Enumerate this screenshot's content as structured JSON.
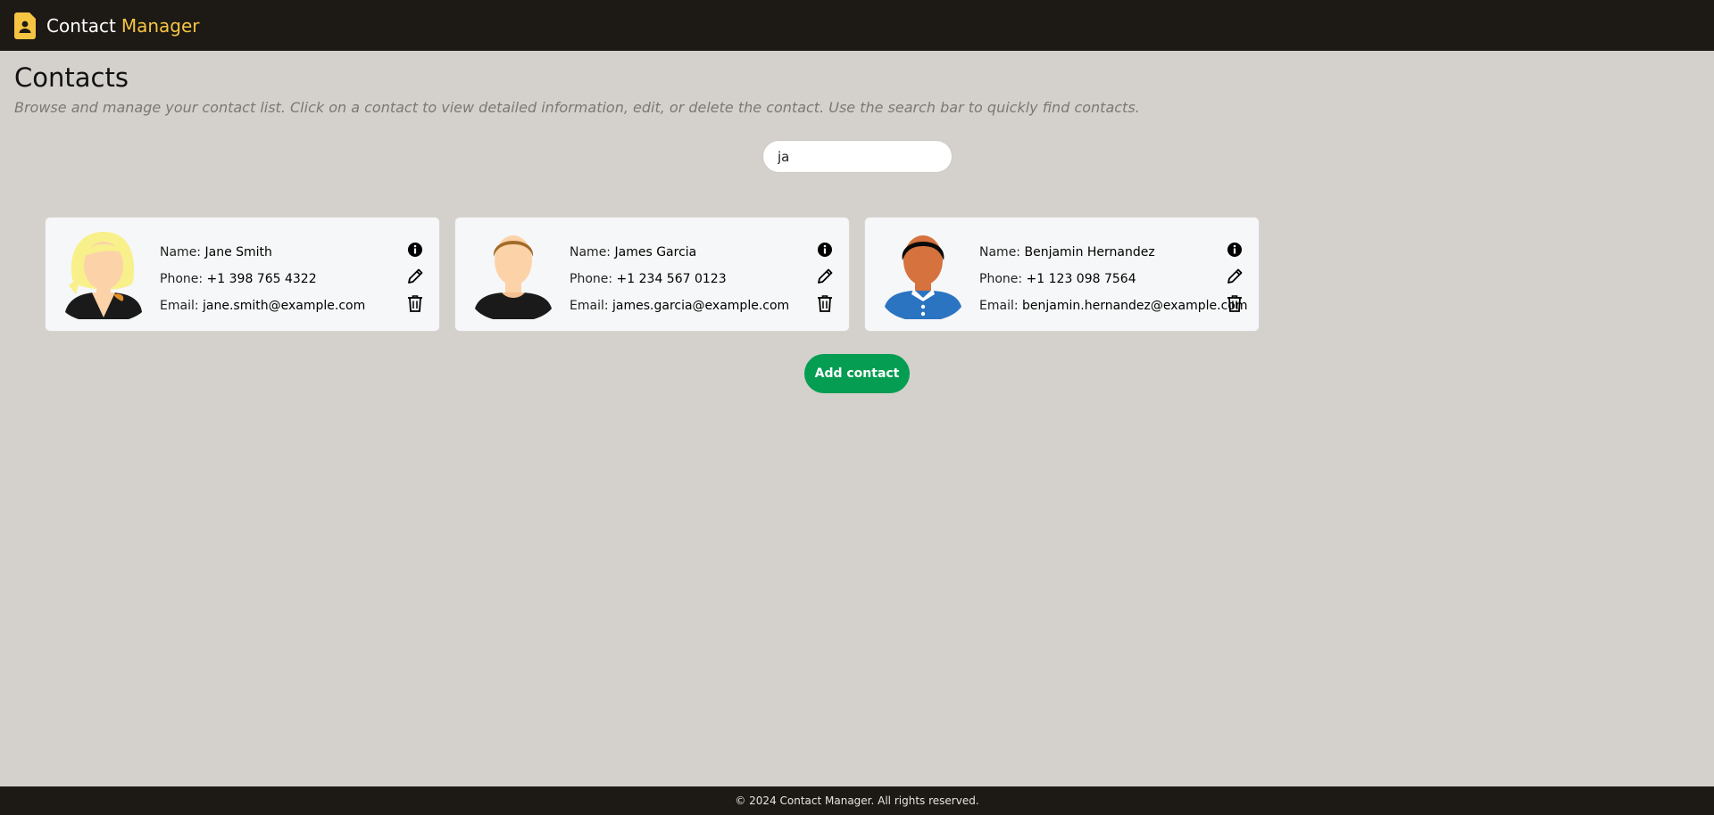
{
  "header": {
    "brand_primary": "Contact",
    "brand_accent": "Manager",
    "accent_color": "#f5c542",
    "logo_icon": "contact-book-icon"
  },
  "main": {
    "title": "Contacts",
    "description": "Browse and manage your contact list. Click on a contact to view detailed information, edit, or delete the contact. Use the search bar to quickly find contacts.",
    "search_value": "ja"
  },
  "labels": {
    "name": "Name:",
    "phone": "Phone:",
    "email": "Email:"
  },
  "contacts": [
    {
      "name": "Jane Smith",
      "phone": "+1 398 765 4322",
      "email": "jane.smith@example.com",
      "avatar": "blonde-woman-avatar"
    },
    {
      "name": "James Garcia",
      "phone": "+1 234 567 0123",
      "email": "james.garcia@example.com",
      "avatar": "brown-haired-man-avatar"
    },
    {
      "name": "Benjamin Hernandez",
      "phone": "+1 123 098 7564",
      "email": "benjamin.hernandez@example.com",
      "avatar": "dark-haired-man-avatar"
    }
  ],
  "actions": {
    "add_contact": "Add contact",
    "add_color": "#049d52"
  },
  "footer": {
    "text": "© 2024 Contact Manager. All rights reserved."
  }
}
